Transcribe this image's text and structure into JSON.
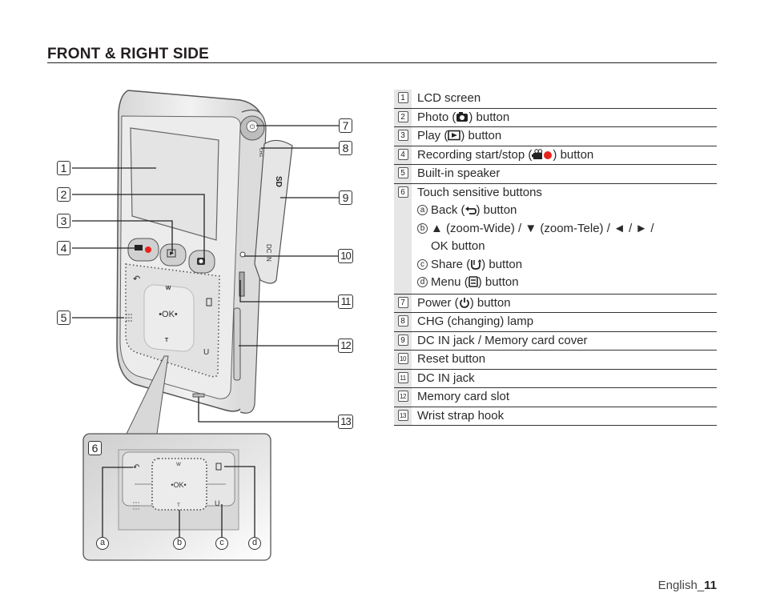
{
  "page": {
    "title": "FRONT & RIGHT SIDE",
    "footer_language": "English_",
    "footer_page": "11"
  },
  "legend": [
    {
      "num": "1",
      "text": "LCD screen"
    },
    {
      "num": "2",
      "text_before": "Photo (",
      "icon": "camera-icon",
      "text_after": ") button"
    },
    {
      "num": "3",
      "text_before": "Play (",
      "icon": "play-icon",
      "text_after": ") button"
    },
    {
      "num": "4",
      "text_before": "Recording start/stop (",
      "icon": "record-icon",
      "text_after": ") button"
    },
    {
      "num": "5",
      "text": "Built-in speaker"
    },
    {
      "num": "6",
      "text": "Touch sensitive buttons",
      "sub": [
        {
          "letter": "a",
          "text_before": "Back (",
          "icon": "back-icon",
          "text_after": ") button"
        },
        {
          "letter": "b",
          "line1": "▲ (zoom-Wide) / ▼ (zoom-Tele) / ◄ / ► /",
          "line2": "OK button"
        },
        {
          "letter": "c",
          "text_before": "Share (",
          "icon": "share-icon",
          "text_after": ") button"
        },
        {
          "letter": "d",
          "text_before": "Menu (",
          "icon": "menu-icon",
          "text_after": ") button"
        }
      ]
    },
    {
      "num": "7",
      "text_before": "Power (",
      "icon": "power-icon",
      "text_after": ") button"
    },
    {
      "num": "8",
      "text": "CHG (changing) lamp"
    },
    {
      "num": "9",
      "text": "DC IN jack / Memory card cover"
    },
    {
      "num": "10",
      "text": "Reset button"
    },
    {
      "num": "11",
      "text": "DC IN jack"
    },
    {
      "num": "12",
      "text": "Memory card slot"
    },
    {
      "num": "13",
      "text": "Wrist strap hook"
    }
  ],
  "diagram": {
    "callouts": [
      "1",
      "2",
      "3",
      "4",
      "5",
      "6",
      "7",
      "8",
      "9",
      "10",
      "11",
      "12",
      "13"
    ],
    "sub_labels": [
      "a",
      "b",
      "c",
      "d"
    ],
    "device_labels": {
      "zoom_wide": "W",
      "zoom_tele": "T",
      "ok": "•OK•",
      "chg": "CHG",
      "dc_in": "DC IN",
      "sd": "SD"
    }
  }
}
